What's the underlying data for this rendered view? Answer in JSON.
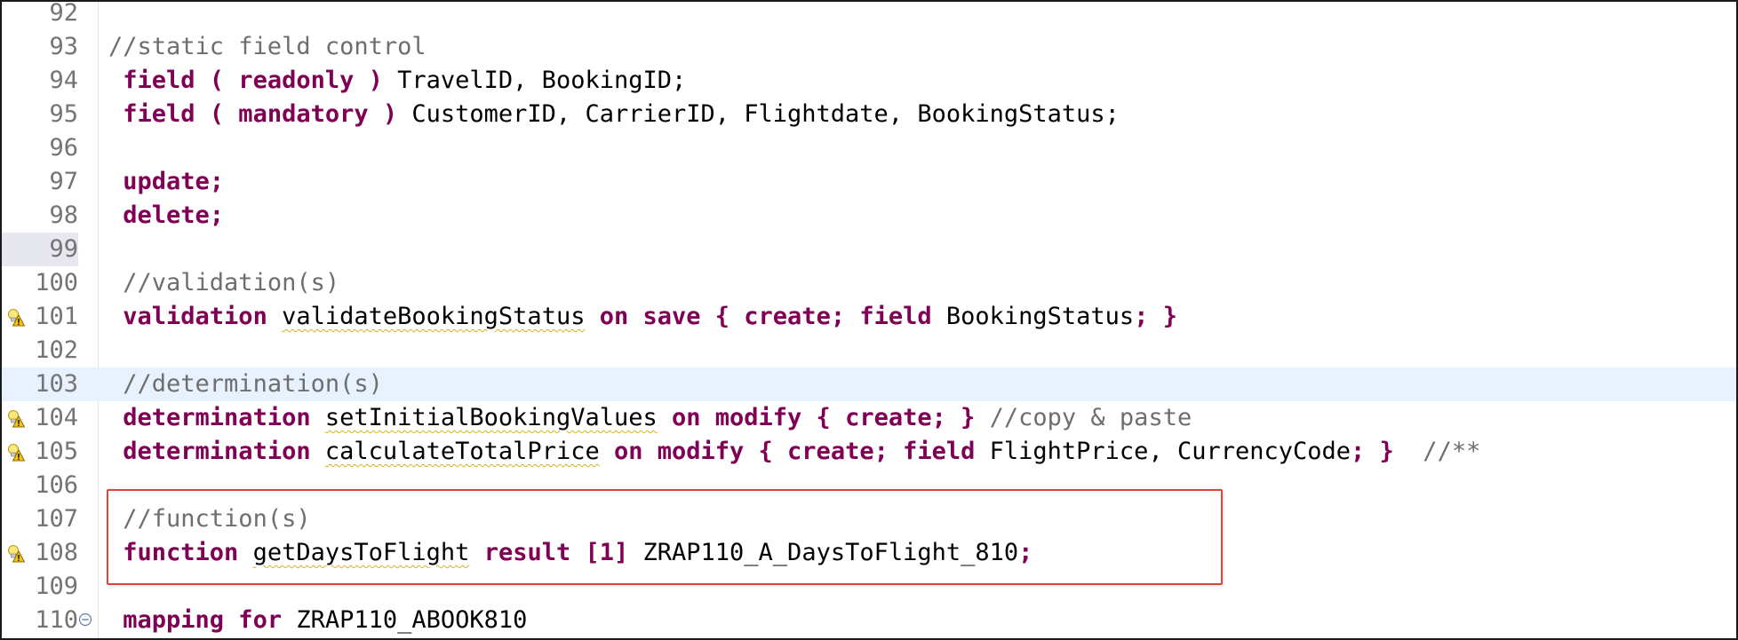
{
  "editor": {
    "lines": [
      {
        "num": "92",
        "tokens": []
      },
      {
        "num": "93",
        "tokens": [
          {
            "t": "cm",
            "v": "//static field control"
          }
        ]
      },
      {
        "num": "94",
        "tokens": [
          {
            "t": "sp",
            "v": " "
          },
          {
            "t": "kw",
            "v": "field ( readonly )"
          },
          {
            "t": "id",
            "v": " TravelID, BookingID;"
          }
        ]
      },
      {
        "num": "95",
        "tokens": [
          {
            "t": "sp",
            "v": " "
          },
          {
            "t": "kw",
            "v": "field ( mandatory )"
          },
          {
            "t": "id",
            "v": " CustomerID, CarrierID, Flightdate, BookingStatus;"
          }
        ]
      },
      {
        "num": "96",
        "tokens": []
      },
      {
        "num": "97",
        "tokens": [
          {
            "t": "sp",
            "v": " "
          },
          {
            "t": "kw",
            "v": "update;"
          }
        ]
      },
      {
        "num": "98",
        "tokens": [
          {
            "t": "sp",
            "v": " "
          },
          {
            "t": "kw",
            "v": "delete;"
          }
        ]
      },
      {
        "num": "99",
        "tokens": [],
        "marked": true
      },
      {
        "num": "100",
        "tokens": [
          {
            "t": "sp",
            "v": " "
          },
          {
            "t": "cm",
            "v": "//validation(s)"
          }
        ]
      },
      {
        "num": "101",
        "warning": true,
        "tokens": [
          {
            "t": "sp",
            "v": " "
          },
          {
            "t": "kw",
            "v": "validation"
          },
          {
            "t": "id",
            "v": " "
          },
          {
            "t": "sq",
            "v": "validateBookingStatus"
          },
          {
            "t": "id",
            "v": " "
          },
          {
            "t": "kw",
            "v": "on save { create; field"
          },
          {
            "t": "id",
            "v": " BookingStatus"
          },
          {
            "t": "kw",
            "v": "; }"
          }
        ]
      },
      {
        "num": "102",
        "tokens": []
      },
      {
        "num": "103",
        "current": true,
        "tokens": [
          {
            "t": "sp",
            "v": " "
          },
          {
            "t": "cm",
            "v": "//determination(s)"
          }
        ]
      },
      {
        "num": "104",
        "warning": true,
        "tokens": [
          {
            "t": "sp",
            "v": " "
          },
          {
            "t": "kw",
            "v": "determination"
          },
          {
            "t": "id",
            "v": " "
          },
          {
            "t": "sq",
            "v": "setInitialBookingValues"
          },
          {
            "t": "id",
            "v": " "
          },
          {
            "t": "kw",
            "v": "on modify { create; }"
          },
          {
            "t": "cm",
            "v": " //copy & paste"
          }
        ]
      },
      {
        "num": "105",
        "warning": true,
        "tokens": [
          {
            "t": "sp",
            "v": " "
          },
          {
            "t": "kw",
            "v": "determination"
          },
          {
            "t": "id",
            "v": " "
          },
          {
            "t": "sq",
            "v": "calculateTotalPrice"
          },
          {
            "t": "id",
            "v": " "
          },
          {
            "t": "kw",
            "v": "on modify { create; field"
          },
          {
            "t": "id",
            "v": " FlightPrice, CurrencyCode"
          },
          {
            "t": "kw",
            "v": "; }"
          },
          {
            "t": "cm",
            "v": "  //**"
          }
        ]
      },
      {
        "num": "106",
        "tokens": []
      },
      {
        "num": "107",
        "tokens": [
          {
            "t": "sp",
            "v": " "
          },
          {
            "t": "cm",
            "v": "//function(s)"
          }
        ]
      },
      {
        "num": "108",
        "warning": true,
        "tokens": [
          {
            "t": "sp",
            "v": " "
          },
          {
            "t": "kw",
            "v": "function"
          },
          {
            "t": "id",
            "v": " "
          },
          {
            "t": "sq",
            "v": "getDaysToFlight"
          },
          {
            "t": "id",
            "v": " "
          },
          {
            "t": "kw",
            "v": "result [1]"
          },
          {
            "t": "id",
            "v": " ZRAP110_A_DaysToFlight_810"
          },
          {
            "t": "kw",
            "v": ";"
          }
        ]
      },
      {
        "num": "109",
        "tokens": []
      },
      {
        "num": "110",
        "fold": true,
        "tokens": [
          {
            "t": "sp",
            "v": " "
          },
          {
            "t": "kw",
            "v": "mapping for"
          },
          {
            "t": "id",
            "v": " ZRAP110_ABOOK810"
          }
        ]
      }
    ]
  },
  "colors": {
    "keyword": "#7f0055",
    "comment": "#6e6e6e",
    "current_line": "#e8f2fe",
    "highlight_box": "#d9453a",
    "warning": "#f2c21b"
  },
  "icons": {
    "warning": "warning-lightbulb-icon",
    "fold": "fold-collapse-icon"
  }
}
